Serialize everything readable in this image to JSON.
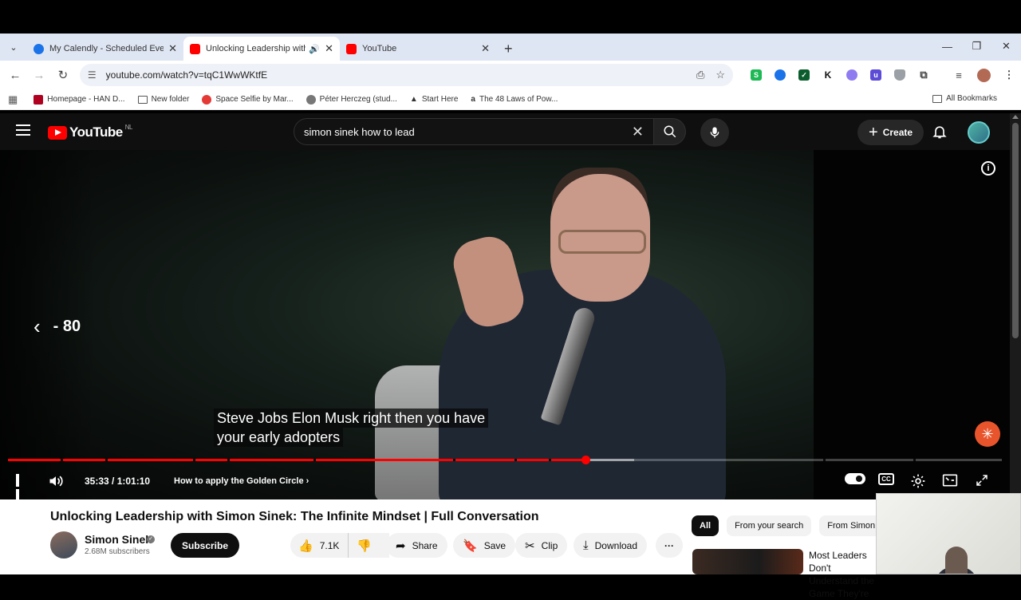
{
  "browser": {
    "tabs": [
      {
        "title": "My Calendly - Scheduled Events",
        "favicon_color": "#1a73e8",
        "active": false
      },
      {
        "title": "Unlocking Leadership with Simon Sinek",
        "favicon_color": "#ff0000",
        "active": true
      },
      {
        "title": "YouTube",
        "favicon_color": "#ff0000",
        "active": false
      }
    ],
    "url": "youtube.com/watch?v=tqC1WwWKtfE",
    "bookmarks": [
      {
        "label": "Homepage - HAN D...",
        "color": "#b00020"
      },
      {
        "label": "New folder",
        "color": "#ffffff"
      },
      {
        "label": "Space Selfie by Mar...",
        "color": "#e53935"
      },
      {
        "label": "Péter Herczeg (stud...",
        "color": "#777777"
      },
      {
        "label": "Start Here",
        "color": "#555555"
      },
      {
        "label": "The 48 Laws of Pow...",
        "color": "#222222"
      }
    ],
    "all_bookmarks": "All Bookmarks",
    "extensions": [
      {
        "icon": "sheets-icon",
        "color": "#1db954",
        "glyph": "S"
      },
      {
        "icon": "circle-ext-icon",
        "color": "#1a73e8",
        "glyph": ""
      },
      {
        "icon": "check-ext-icon",
        "color": "#0b5d2e",
        "glyph": "✓"
      },
      {
        "icon": "k-ext-icon",
        "color": "#ffffff",
        "glyph": "K"
      },
      {
        "icon": "cloud-ext-icon",
        "color": "#8f7cf0",
        "glyph": ""
      },
      {
        "icon": "u-ext-icon",
        "color": "#5b4bd6",
        "glyph": "u"
      },
      {
        "icon": "shield-ext-icon",
        "color": "#9aa0a6",
        "glyph": ""
      }
    ]
  },
  "youtube": {
    "logo_text": "YouTube",
    "region": "NL",
    "search_query": "simon sinek how to lead",
    "create_label": "Create"
  },
  "player": {
    "seek_label": "- 80",
    "caption_line1": "Steve Jobs Elon Musk right then you have",
    "caption_line2": "your early adopters",
    "time": "35:33 / 1:01:10",
    "chapter": "How to apply the Golden Circle",
    "played_fraction": 0.581,
    "buffered_fraction": 0.63
  },
  "video": {
    "title": "Unlocking Leadership with Simon Sinek: The Infinite Mindset | Full Conversation",
    "channel": "Simon Sinek",
    "subscribers": "2.68M subscribers",
    "subscribe_label": "Subscribe",
    "likes": "7.1K",
    "share_label": "Share",
    "save_label": "Save",
    "clip_label": "Clip",
    "download_label": "Download"
  },
  "chips": [
    "All",
    "From your search",
    "From Simon"
  ],
  "recommendation": {
    "title": "Most Leaders Don't Understand the Game They're"
  }
}
